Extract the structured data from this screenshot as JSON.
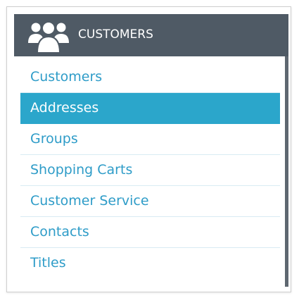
{
  "header": {
    "title": "CUSTOMERS",
    "icon": "customers-group-icon",
    "background": "#4f5a65"
  },
  "menu": {
    "accent": "#2ba6cb",
    "link_color": "#2e9cc8",
    "items": [
      {
        "label": "Customers",
        "active": false
      },
      {
        "label": "Addresses",
        "active": true
      },
      {
        "label": "Groups",
        "active": false
      },
      {
        "label": "Shopping Carts",
        "active": false
      },
      {
        "label": "Customer Service",
        "active": false
      },
      {
        "label": "Contacts",
        "active": false
      },
      {
        "label": "Titles",
        "active": false
      }
    ]
  }
}
